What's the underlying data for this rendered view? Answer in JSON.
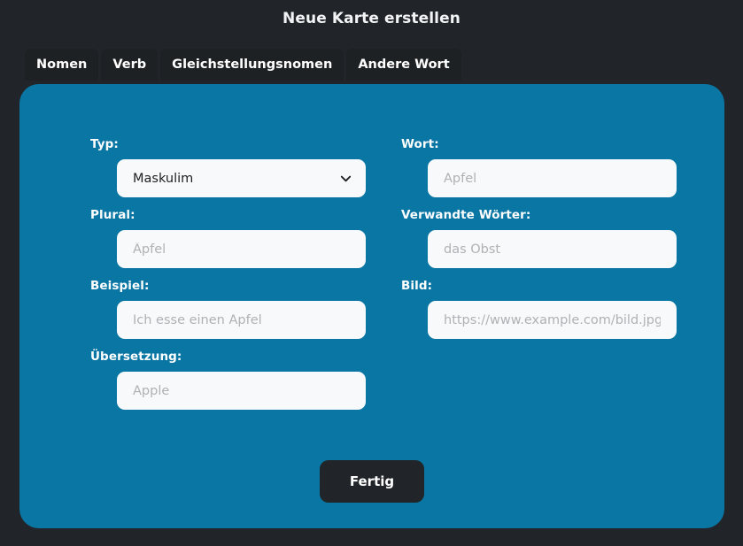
{
  "page": {
    "title": "Neue Karte erstellen",
    "accent_color": "#0a76a4",
    "background_color": "#212529",
    "tab_background_color": "#1e2124",
    "input_background_color": "#f8f9fa"
  },
  "tabs": [
    {
      "label": "Nomen"
    },
    {
      "label": "Verb"
    },
    {
      "label": "Gleichstellungsnomen"
    },
    {
      "label": "Andere Wort"
    }
  ],
  "form": {
    "typ": {
      "label": "Typ:",
      "value": "Maskulim",
      "options": [
        "Maskulim"
      ],
      "icon": "chevron-down-icon"
    },
    "wort": {
      "label": "Wort:",
      "value": "",
      "placeholder": "Apfel"
    },
    "plural": {
      "label": "Plural:",
      "value": "",
      "placeholder": "Äpfel"
    },
    "verwandte_woerter": {
      "label": "Verwandte Wörter:",
      "value": "",
      "placeholder": "das Obst"
    },
    "beispiel": {
      "label": "Beispiel:",
      "value": "",
      "placeholder": "Ich esse einen Apfel"
    },
    "bild": {
      "label": "Bild:",
      "value": "",
      "placeholder": "https://www.example.com/bild.jpg"
    },
    "uebersetzung": {
      "label": "Übersetzung:",
      "value": "",
      "placeholder": "Apple"
    }
  },
  "submit": {
    "label": "Fertig"
  }
}
